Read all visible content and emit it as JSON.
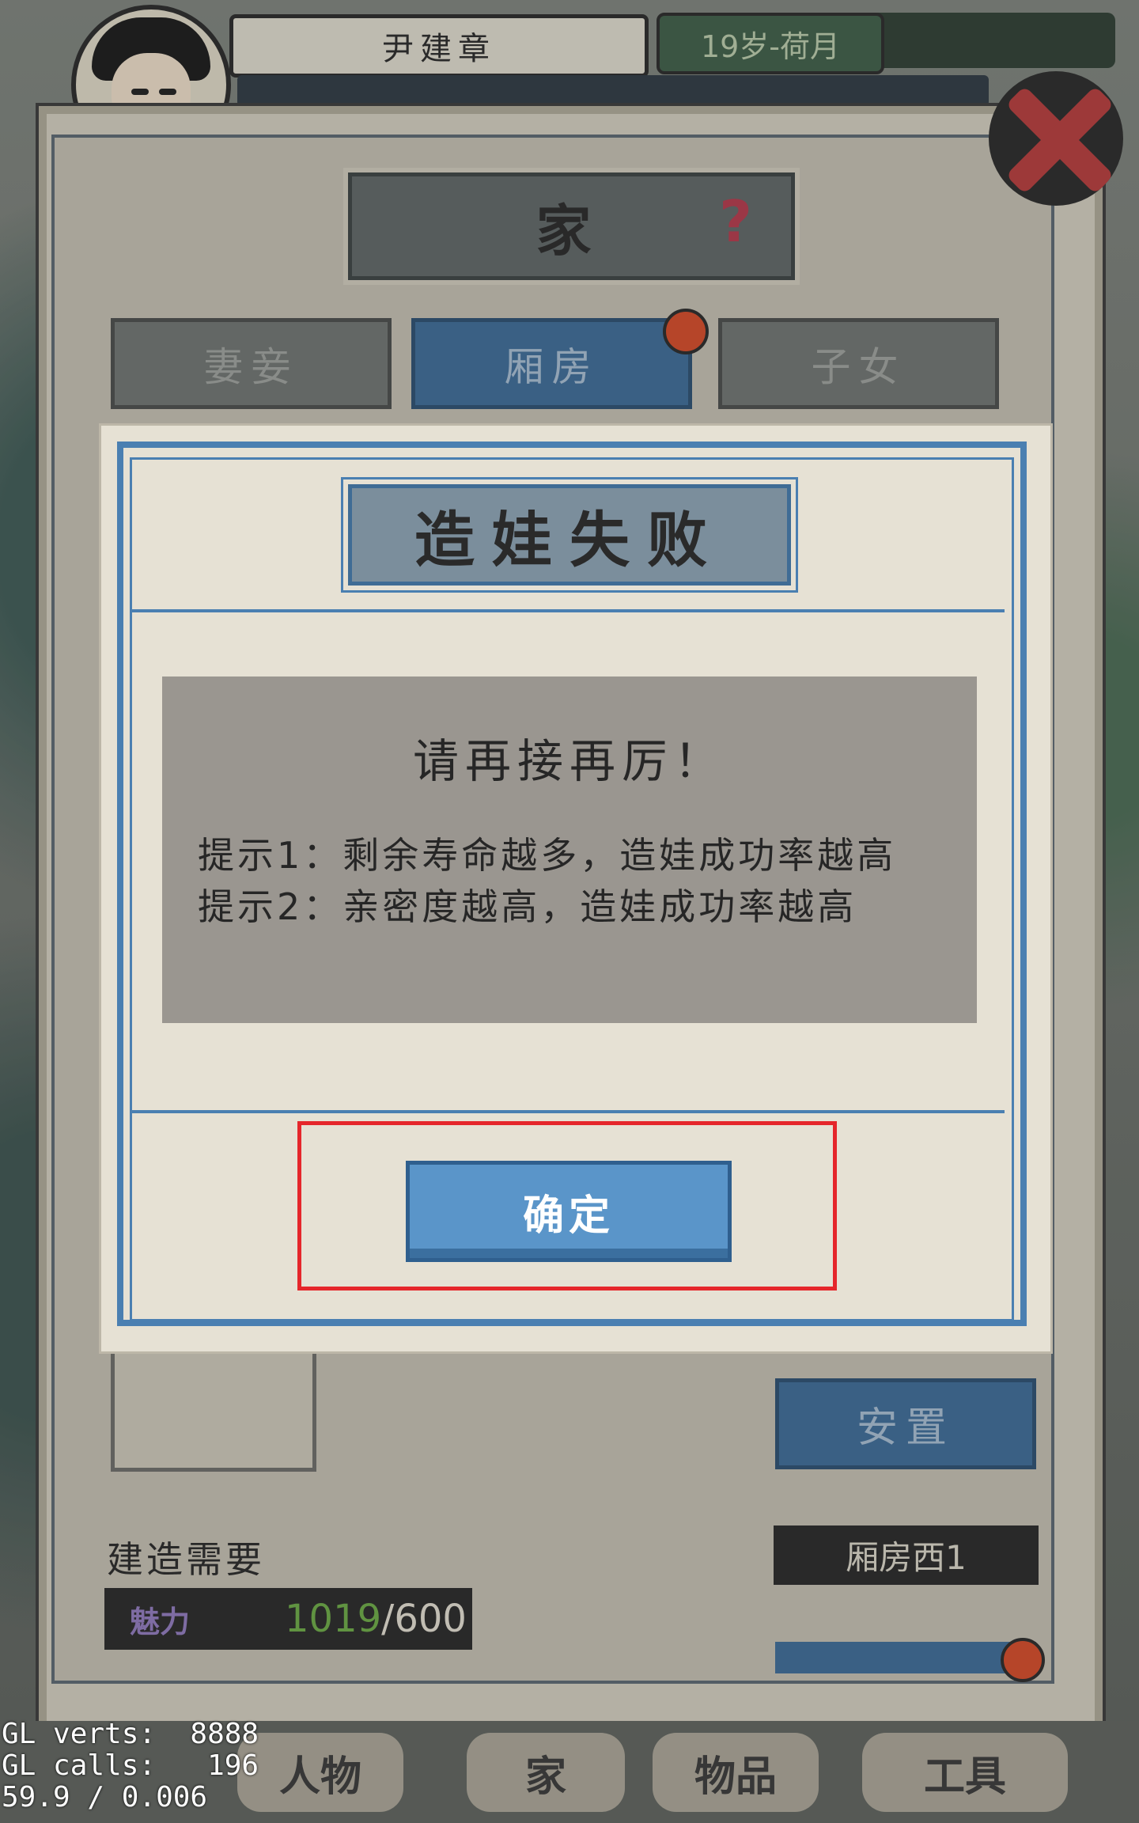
{
  "player": {
    "name": "尹建章",
    "age_month": "19岁-荷月"
  },
  "panel": {
    "title": "家",
    "help_icon": "?",
    "tabs": [
      "妻妾",
      "厢房",
      "子女"
    ],
    "active_tab": 1,
    "place_button": "安置",
    "build_label": "建造需要",
    "room_tag": "厢房西1",
    "charm": {
      "label": "魅力",
      "current": "1019",
      "separator": "/",
      "required": "600"
    }
  },
  "dialog": {
    "title": "造娃失败",
    "headline": "请再接再厉！",
    "tip1": "提示1：剩余寿命越多，造娃成功率越高",
    "tip2": "提示2：亲密度越高，造娃成功率越高",
    "confirm": "确定"
  },
  "bottom_nav": [
    "人物",
    "家",
    "物品",
    "工具"
  ],
  "debug": {
    "line1": "GL verts:  8888",
    "line2": "GL calls:   196",
    "line3": "59.9 / 0.006"
  },
  "colors": {
    "accent_blue": "#5a95c9",
    "tab_active": "#3e6a95",
    "notification": "#cf4b2a",
    "highlight": "#e5262b",
    "charm_current": "#6aa646"
  },
  "icons": [
    "close-icon",
    "help-icon",
    "notification-dot-icon"
  ]
}
